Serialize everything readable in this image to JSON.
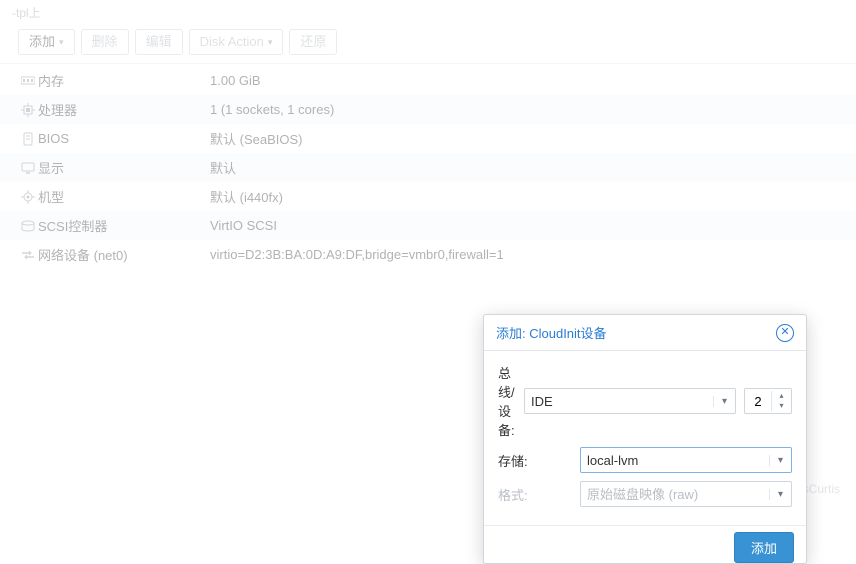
{
  "header_scrap": "-tpl上",
  "toolbar": {
    "add": "添加",
    "remove": "删除",
    "edit": "编辑",
    "disk_action": "Disk Action",
    "revert": "还原"
  },
  "rows": [
    {
      "icon": "memory",
      "label": "内存",
      "value": "1.00 GiB"
    },
    {
      "icon": "cpu",
      "label": "处理器",
      "value": "1 (1 sockets, 1 cores)"
    },
    {
      "icon": "bios",
      "label": "BIOS",
      "value": "默认 (SeaBIOS)"
    },
    {
      "icon": "display",
      "label": "显示",
      "value": "默认"
    },
    {
      "icon": "machine",
      "label": "机型",
      "value": "默认 (i440fx)"
    },
    {
      "icon": "scsi",
      "label": "SCSI控制器",
      "value": "VirtIO SCSI"
    },
    {
      "icon": "net",
      "label": "网络设备 (net0)",
      "value": "virtio=D2:3B:BA:0D:A9:DF,bridge=vmbr0,firewall=1"
    }
  ],
  "dialog": {
    "title": "添加: CloudInit设备",
    "bus_label": "总线/设备:",
    "bus_value": "IDE",
    "bus_index": "2",
    "storage_label": "存储:",
    "storage_value": "local-lvm",
    "format_label": "格式:",
    "format_value": "原始磁盘映像 (raw)",
    "submit": "添加"
  },
  "watermark": "CSDN @JamesCurtis"
}
